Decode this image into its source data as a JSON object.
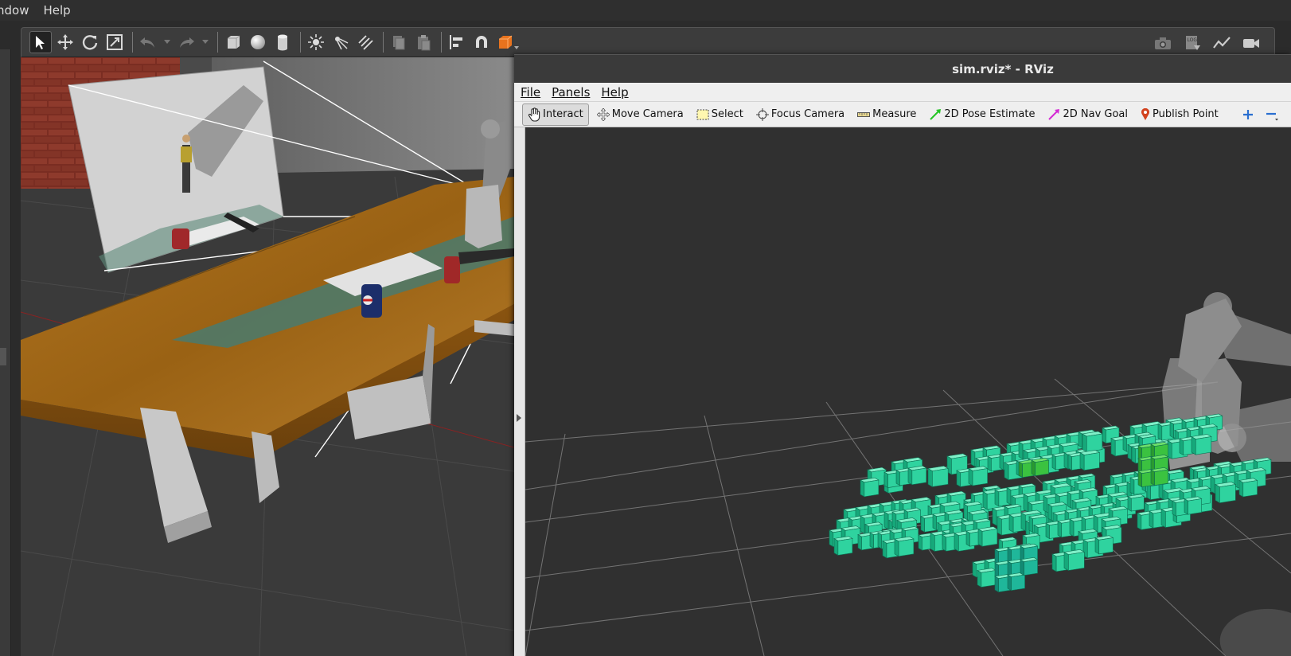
{
  "gazebo": {
    "menu": [
      "ndow",
      "Help"
    ]
  },
  "rviz": {
    "title": "sim.rviz* - RViz",
    "menu": {
      "file": "File",
      "panels": "Panels",
      "help": "Help"
    },
    "tools": [
      {
        "label": "Interact",
        "icon": "hand-icon"
      },
      {
        "label": "Move Camera",
        "icon": "move-camera-icon"
      },
      {
        "label": "Select",
        "icon": "select-icon"
      },
      {
        "label": "Focus Camera",
        "icon": "focus-camera-icon"
      },
      {
        "label": "Measure",
        "icon": "ruler-icon"
      },
      {
        "label": "2D Pose Estimate",
        "icon": "green-arrow-icon"
      },
      {
        "label": "2D Nav Goal",
        "icon": "magenta-arrow-icon"
      },
      {
        "label": "Publish Point",
        "icon": "map-pin-icon"
      }
    ],
    "colors": {
      "voxel": "#2fd39f",
      "voxel_dark": "#16a87a",
      "voxel_highlight": "#3bc240",
      "grid": "#8a8a8a"
    }
  }
}
